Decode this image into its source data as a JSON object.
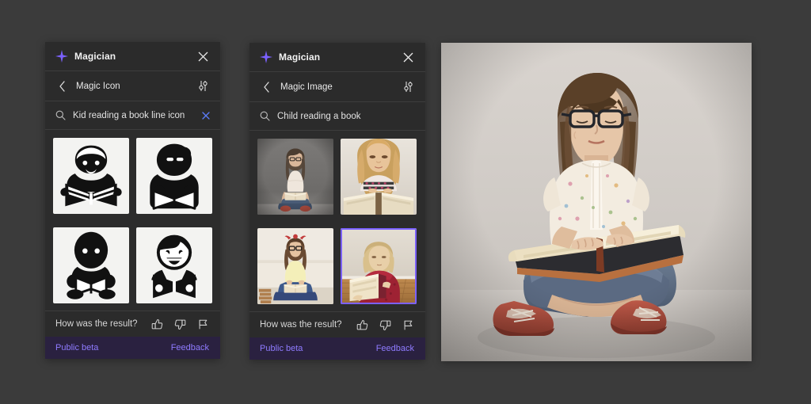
{
  "background_color": "#3b3b3b",
  "accent_color": "#7b61ff",
  "footer_bg": "#2a2140",
  "panels": [
    {
      "id": "magic-icon",
      "brand": "Magician",
      "brand_icon": "sparkle-icon",
      "close_icon": "close-icon",
      "back_icon": "chevron-left-icon",
      "settings_icon": "sliders-icon",
      "tool_title": "Magic Icon",
      "search": {
        "icon": "search-icon",
        "value": "Kid reading a book line icon",
        "placeholder": "Search",
        "clear_icon": "clear-icon",
        "has_clear": true
      },
      "results": [
        {
          "name": "icon-result-1",
          "alt": "Kid with hair reading open book line icon",
          "selected": false
        },
        {
          "name": "icon-result-2",
          "alt": "Child figure holding open book icon",
          "selected": false
        },
        {
          "name": "icon-result-3",
          "alt": "Seated child reading book icon",
          "selected": false
        },
        {
          "name": "icon-result-4",
          "alt": "Smiling boy reading book icon",
          "selected": false
        }
      ],
      "feedback": {
        "question": "How was the result?",
        "thumbs_up": "thumbs-up-icon",
        "thumbs_down": "thumbs-down-icon",
        "flag": "flag-icon"
      },
      "footer": {
        "status": "Public beta",
        "action": "Feedback"
      }
    },
    {
      "id": "magic-image",
      "brand": "Magician",
      "brand_icon": "sparkle-icon",
      "close_icon": "close-icon",
      "back_icon": "chevron-left-icon",
      "settings_icon": "sliders-icon",
      "tool_title": "Magic Image",
      "search": {
        "icon": "search-icon",
        "value": "Child reading a book",
        "placeholder": "Search",
        "clear_icon": "clear-icon",
        "has_clear": false
      },
      "results": [
        {
          "name": "image-result-1",
          "alt": "Girl with glasses sitting cross-legged reading a book, grey backdrop",
          "selected": false
        },
        {
          "name": "image-result-2",
          "alt": "Blonde girl in patterned top reading a thick open book",
          "selected": false
        },
        {
          "name": "image-result-3",
          "alt": "Girl with glasses and red hair bow reading on a bed",
          "selected": false
        },
        {
          "name": "image-result-4",
          "alt": "Blonde girl in red dress reading a book on a wooden floor",
          "selected": true
        }
      ],
      "feedback": {
        "question": "How was the result?",
        "thumbs_up": "thumbs-up-icon",
        "thumbs_down": "thumbs-down-icon",
        "flag": "flag-icon"
      },
      "footer": {
        "status": "Public beta",
        "action": "Feedback"
      }
    }
  ],
  "preview": {
    "name": "preview-image",
    "alt": "Girl with glasses sitting cross-legged on the floor reading a large open book, wearing a floral top, jeans and red sneakers, against a light grey wall"
  }
}
